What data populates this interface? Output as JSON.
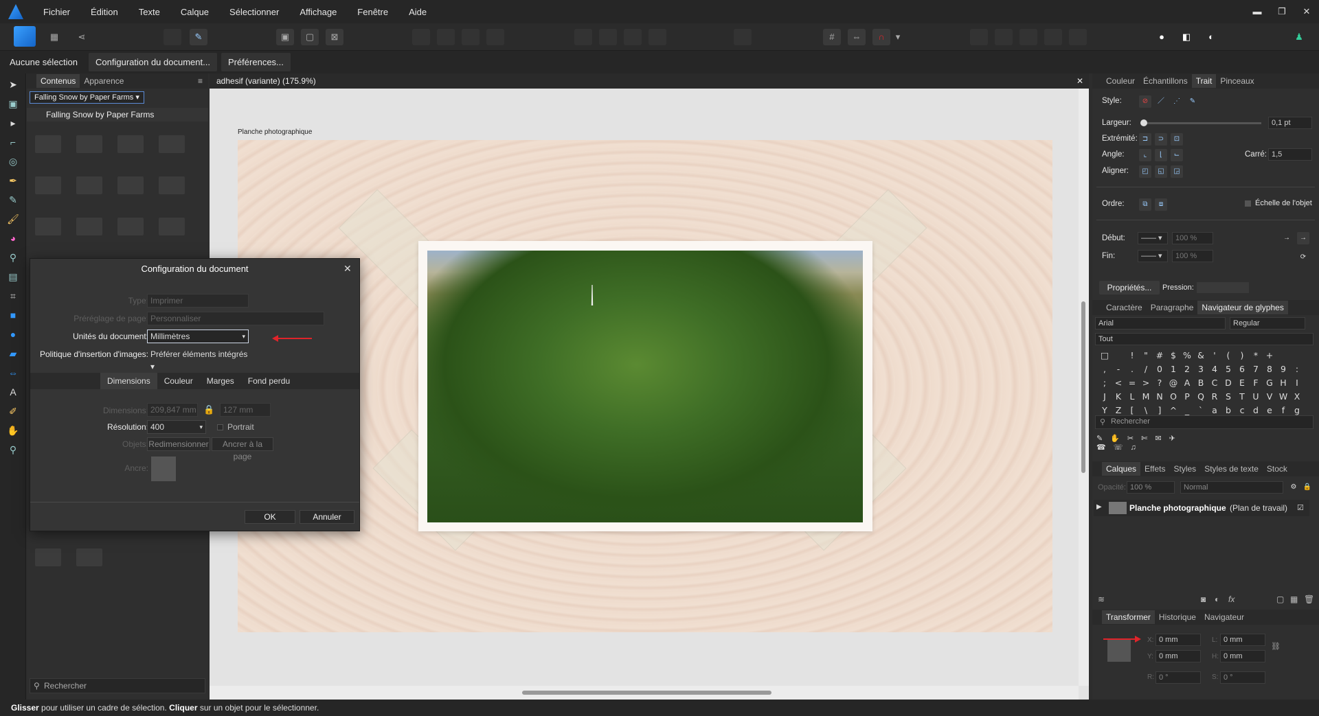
{
  "menubar": {
    "items": [
      "Fichier",
      "Édition",
      "Texte",
      "Calque",
      "Sélectionner",
      "Affichage",
      "Fenêtre",
      "Aide"
    ],
    "minimize": "▬",
    "maximize": "❐",
    "close": "✕"
  },
  "contextbar": {
    "selection": "Aucune sélection",
    "doc_setup": "Configuration du document...",
    "preferences": "Préférences..."
  },
  "left_panel": {
    "tab_contents": "Contenus",
    "tab_appearance": "Apparence",
    "pack_selector": "Falling Snow by Paper Farms",
    "pack_title": "Falling Snow by Paper Farms",
    "search_placeholder": "Rechercher"
  },
  "document": {
    "tab_title": "adhesif (variante) (175.9%)",
    "artboard_label": "Planche photographique",
    "close": "✕"
  },
  "dialog": {
    "title": "Configuration du document",
    "type_label": "Type:",
    "type_value": "Imprimer",
    "preset_label": "Préréglage de page:",
    "preset_value": "Personnaliser",
    "units_label": "Unités du document:",
    "units_value": "Millimètres",
    "policy_label": "Politique d'insertion d'images:",
    "policy_value": "Préférer éléments intégrés",
    "tabs": [
      "Dimensions",
      "Couleur",
      "Marges",
      "Fond perdu"
    ],
    "dimensions_label": "Dimensions:",
    "width_value": "209,847 mm",
    "height_value": "127 mm",
    "resolution_label": "Résolution:",
    "resolution_value": "400",
    "portrait_label": "Portrait",
    "objects_label": "Objets:",
    "resize_button": "Redimensionner",
    "anchor_page_button": "Ancrer à la page",
    "anchor_label": "Ancre:",
    "ok": "OK",
    "cancel": "Annuler"
  },
  "stroke_panel": {
    "tabs": [
      "Couleur",
      "Échantillons",
      "Trait",
      "Pinceaux"
    ],
    "style_label": "Style:",
    "width_label": "Largeur:",
    "width_value": "0,1 pt",
    "cap_label": "Extrémité:",
    "join_label": "Angle:",
    "miter_label": "Carré:",
    "miter_value": "1,5",
    "align_label": "Aligner:",
    "order_label": "Ordre:",
    "scale_label": "Échelle de l'objet",
    "start_label": "Début:",
    "start_pct": "100 %",
    "end_label": "Fin:",
    "end_pct": "100 %",
    "properties_button": "Propriétés...",
    "pressure_label": "Pression:"
  },
  "glyph_panel": {
    "tabs": [
      "Caractère",
      "Paragraphe",
      "Navigateur de glyphes"
    ],
    "font": "Arial",
    "weight": "Regular",
    "range": "Tout",
    "rows": [
      [
        "□",
        "",
        "!",
        "\"",
        "#",
        "$",
        "%",
        "&",
        "'",
        "(",
        ")",
        "*",
        "+"
      ],
      [
        ",",
        "-",
        ".",
        "/",
        "0",
        "1",
        "2",
        "3",
        "4",
        "5",
        "6",
        "7",
        "8",
        "9",
        ":"
      ],
      [
        ";",
        "<",
        "=",
        ">",
        "?",
        "@",
        "A",
        "B",
        "C",
        "D",
        "E",
        "F",
        "G",
        "H",
        "I"
      ],
      [
        "J",
        "K",
        "L",
        "M",
        "N",
        "O",
        "P",
        "Q",
        "R",
        "S",
        "T",
        "U",
        "V",
        "W",
        "X"
      ],
      [
        "Y",
        "Z",
        "[",
        "\\",
        "]",
        "^",
        "_",
        "`",
        "a",
        "b",
        "c",
        "d",
        "e",
        "f",
        "g"
      ]
    ],
    "search_placeholder": "Rechercher"
  },
  "layers_panel": {
    "tabs": [
      "Calques",
      "Effets",
      "Styles",
      "Styles de texte",
      "Stock"
    ],
    "opacity_label": "Opacité:",
    "opacity_value": "100 %",
    "blend_value": "Normal",
    "layer_name": "Planche photographique",
    "layer_type": "(Plan de travail)"
  },
  "transform_panel": {
    "tabs": [
      "Transformer",
      "Historique",
      "Navigateur"
    ],
    "x_label": "X:",
    "x_value": "0 mm",
    "y_label": "Y:",
    "y_value": "0 mm",
    "w_label": "L:",
    "w_value": "0 mm",
    "h_label": "H:",
    "h_value": "0 mm",
    "r_label": "R:",
    "r_value": "0 °",
    "s_label": "S:",
    "s_value": "0 °"
  },
  "statusbar": {
    "b1": "Glisser",
    "t1": " pour utiliser un cadre de sélection. ",
    "b2": "Cliquer",
    "t2": " sur un objet pour le sélectionner."
  },
  "colors": {
    "accent": "#3a9bff",
    "annotation_arrow": "#e0242a"
  }
}
